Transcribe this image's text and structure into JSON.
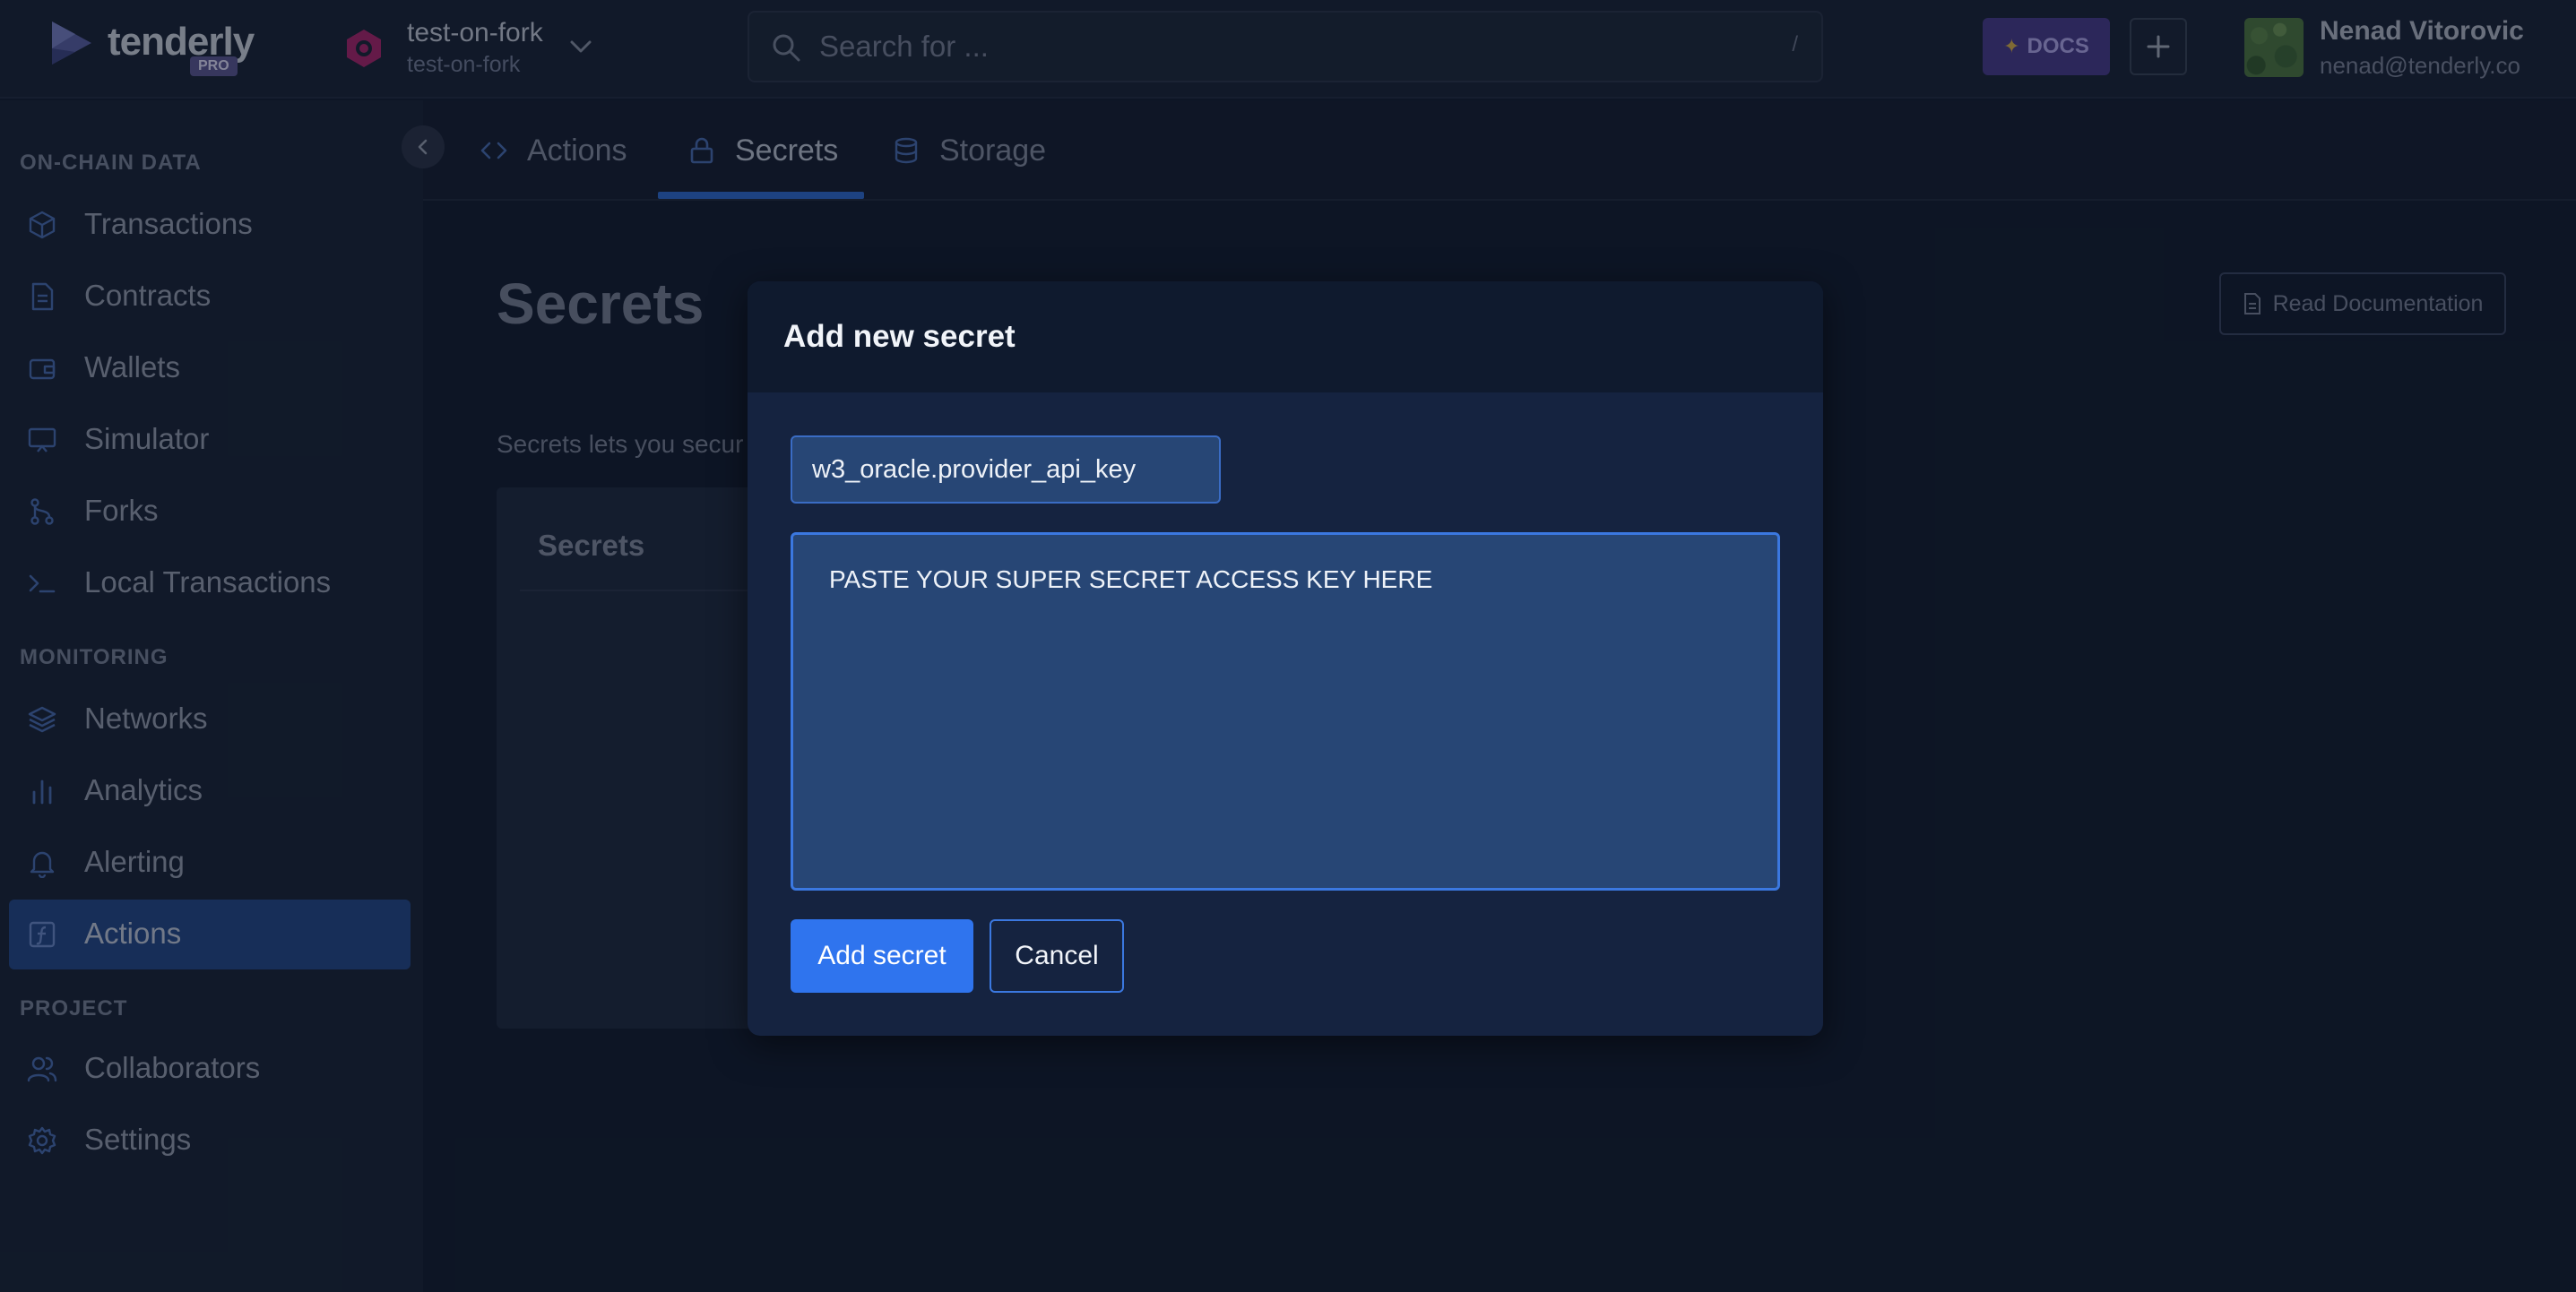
{
  "app": {
    "brand": "tenderly",
    "plan_badge": "PRO"
  },
  "project": {
    "name": "test-on-fork",
    "slug": "test-on-fork"
  },
  "search": {
    "placeholder": "Search for ...",
    "value": "",
    "shortcut": "/"
  },
  "header": {
    "docs_label": "DOCS"
  },
  "user": {
    "name": "Nenad Vitorovic",
    "email": "nenad@tenderly.co"
  },
  "sidebar": {
    "sections": [
      {
        "title": "ON-CHAIN DATA",
        "items": [
          {
            "label": "Transactions",
            "icon": "cube-icon"
          },
          {
            "label": "Contracts",
            "icon": "document-icon"
          },
          {
            "label": "Wallets",
            "icon": "wallet-icon"
          },
          {
            "label": "Simulator",
            "icon": "monitor-icon"
          },
          {
            "label": "Forks",
            "icon": "fork-icon"
          },
          {
            "label": "Local Transactions",
            "icon": "terminal-icon"
          }
        ]
      },
      {
        "title": "MONITORING",
        "items": [
          {
            "label": "Networks",
            "icon": "layers-icon"
          },
          {
            "label": "Analytics",
            "icon": "bar-chart-icon"
          },
          {
            "label": "Alerting",
            "icon": "bell-icon"
          },
          {
            "label": "Actions",
            "icon": "function-icon",
            "active": true
          }
        ]
      },
      {
        "title": "PROJECT",
        "items": [
          {
            "label": "Collaborators",
            "icon": "users-icon"
          },
          {
            "label": "Settings",
            "icon": "gear-icon"
          }
        ]
      }
    ]
  },
  "tabs": [
    {
      "label": "Actions",
      "icon": "code-icon"
    },
    {
      "label": "Secrets",
      "icon": "lock-icon",
      "active": true
    },
    {
      "label": "Storage",
      "icon": "database-icon"
    }
  ],
  "page": {
    "title": "Secrets",
    "read_docs_label": "Read Documentation",
    "description": "Secrets lets you secur",
    "card_title": "Secrets"
  },
  "modal": {
    "title": "Add new secret",
    "name_value": "w3_oracle.provider_api_key",
    "secret_value": "PASTE YOUR SUPER SECRET ACCESS KEY HERE",
    "submit_label": "Add secret",
    "cancel_label": "Cancel"
  },
  "colors": {
    "accent": "#2f74ee",
    "active_nav": "#234a8a",
    "docs": "#4a3d8f",
    "background": "#121c2e"
  }
}
